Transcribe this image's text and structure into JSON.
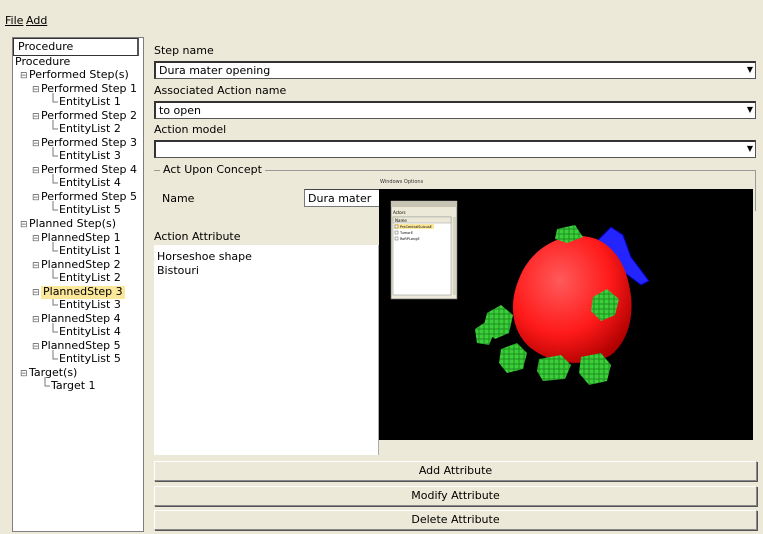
{
  "menu": {
    "file": "File",
    "add": "Add"
  },
  "tree": {
    "header": "Procedure",
    "nodes": [
      {
        "label": "Procedure"
      },
      {
        "label": "Performed Step(s)"
      },
      {
        "label": "Performed Step 1"
      },
      {
        "label": "EntityList 1"
      },
      {
        "label": "Performed Step 2"
      },
      {
        "label": "EntityList 2"
      },
      {
        "label": "Performed Step 3"
      },
      {
        "label": "EntityList 3"
      },
      {
        "label": "Performed Step 4"
      },
      {
        "label": "EntityList 4"
      },
      {
        "label": "Performed Step 5"
      },
      {
        "label": "EntityList 5"
      },
      {
        "label": "Planned Step(s)"
      },
      {
        "label": "PlannedStep 1"
      },
      {
        "label": "EntityList 1"
      },
      {
        "label": "PlannedStep 2"
      },
      {
        "label": "EntityList 2"
      },
      {
        "label": "PlannedStep 3"
      },
      {
        "label": "EntityList 3"
      },
      {
        "label": "PlannedStep 4"
      },
      {
        "label": "EntityList 4"
      },
      {
        "label": "PlannedStep 5"
      },
      {
        "label": "EntityList 5"
      },
      {
        "label": "Target(s)"
      },
      {
        "label": "Target 1"
      }
    ],
    "selected": "PlannedStep 3"
  },
  "form": {
    "step_name_label": "Step name",
    "step_name_value": "Dura mater opening",
    "action_name_label": "Associated Action name",
    "action_name_value": "to open",
    "action_model_label": "Action model",
    "action_model_value": "",
    "group_title": "Act Upon Concept",
    "name_label": "Name",
    "name_value": "Dura mater",
    "action_attribute_label": "Action Attribute",
    "attributes": [
      "Horseshoe shape",
      "Bistouri"
    ]
  },
  "viewer": {
    "caption": "Windows Options",
    "mini_panel_title": "Actors",
    "mini_panel_header": "Name",
    "mini_items": [
      "PreCentralSulcusE",
      "TumorE",
      "RoRPLangE"
    ]
  },
  "buttons": {
    "add": "Add Attribute",
    "modify": "Modify Attribute",
    "delete": "Delete Attribute"
  },
  "colors": {
    "selection": "#fce89a",
    "tumor": "#ff1a1a",
    "gyrus": "#2a2aff",
    "electrodes": "#2db52d"
  }
}
